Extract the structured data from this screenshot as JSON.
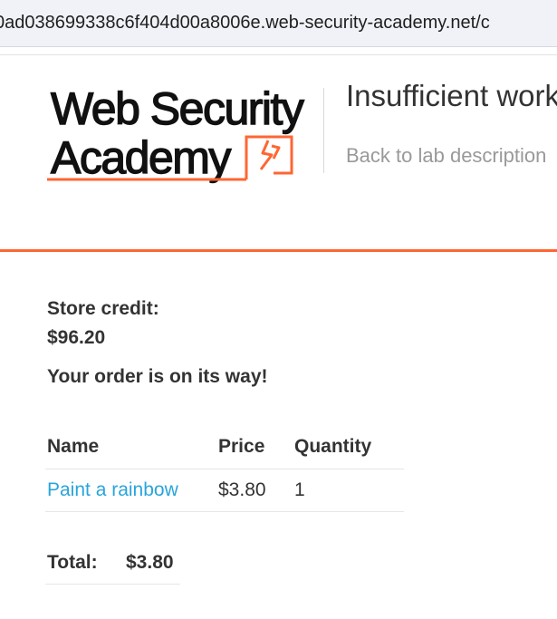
{
  "browser": {
    "url": "0ad038699338c6f404d00a8006e.web-security-academy.net/c"
  },
  "header": {
    "logo_text_line1": "Web Security",
    "logo_text_line2": "Academy",
    "lab_title": "Insufficient workflow validation",
    "back_link": "Back to lab description"
  },
  "colors": {
    "accent": "#ff6633",
    "link": "#29a4dc",
    "text": "#333333",
    "muted": "#999999"
  },
  "store": {
    "credit_label": "Store credit:",
    "credit_value": "$96.20",
    "order_message": "Your order is on its way!"
  },
  "cart": {
    "headers": [
      "Name",
      "Price",
      "Quantity"
    ],
    "rows": [
      {
        "name": "Paint a rainbow",
        "price": "$3.80",
        "quantity": "1"
      }
    ]
  },
  "total": {
    "label": "Total:",
    "value": "$3.80"
  }
}
